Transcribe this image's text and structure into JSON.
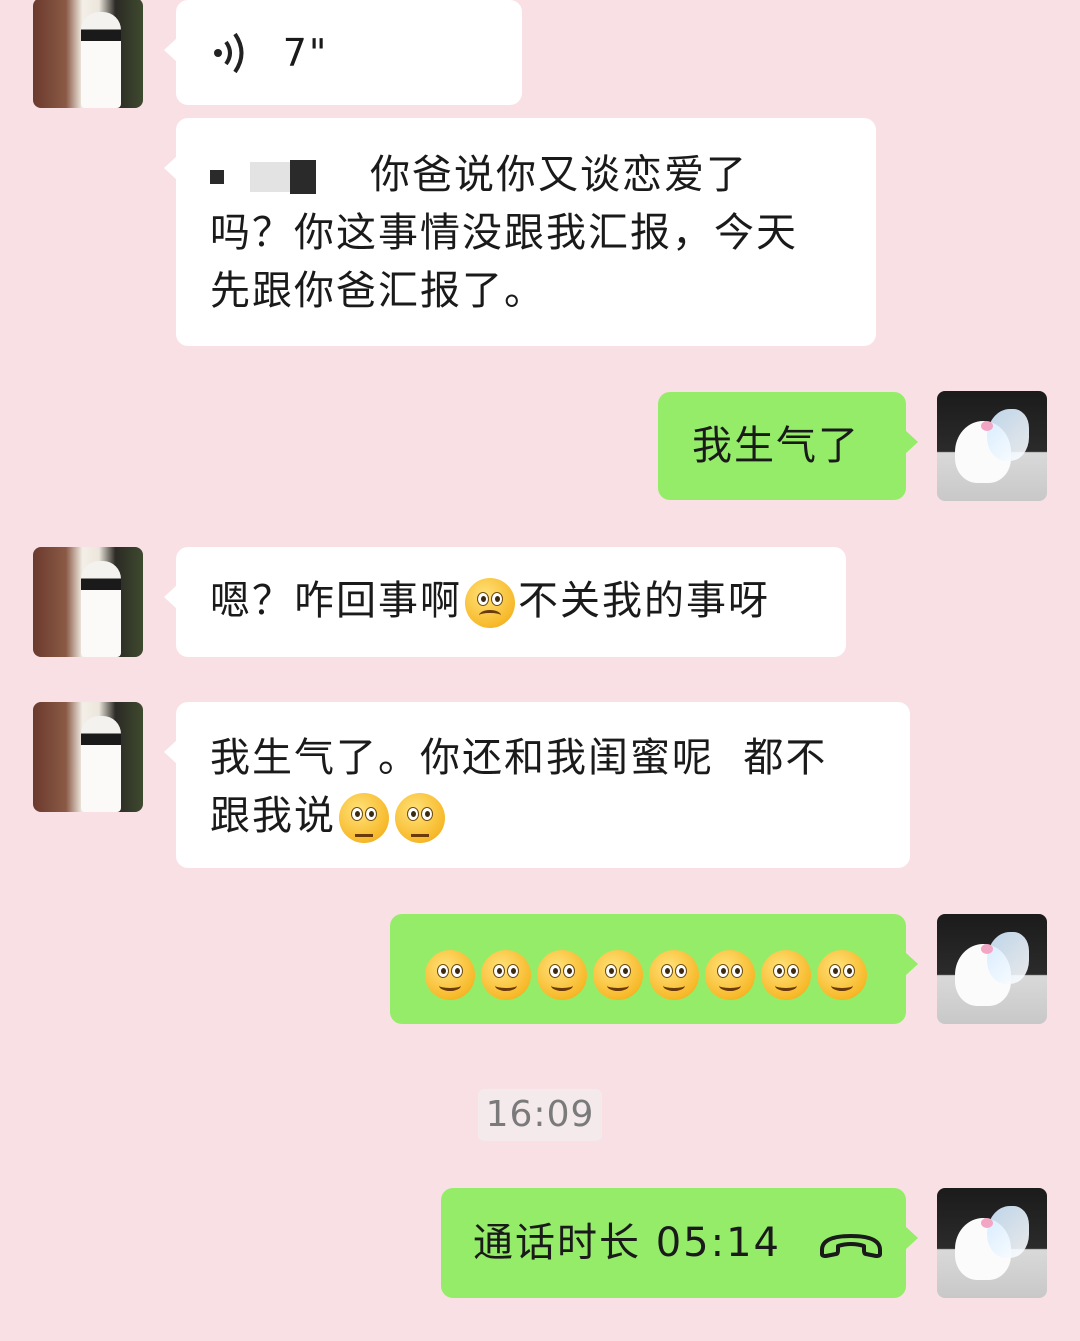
{
  "messages": [
    {
      "side": "left",
      "type": "voice",
      "duration": "7\""
    },
    {
      "side": "left",
      "type": "text",
      "lines": [
        "你爸说你又谈恋爱了",
        "吗？你这事情没跟我汇报，今天",
        "先跟你爸汇报了。"
      ]
    },
    {
      "side": "right",
      "type": "text",
      "text": "我生气了"
    },
    {
      "side": "left",
      "type": "text",
      "text_before": "嗯？咋回事啊",
      "emoji": "frowning-face",
      "text_after": "不关我的事呀"
    },
    {
      "side": "left",
      "type": "text",
      "lines": [
        "我生气了。你还和我闺蜜呢  都不",
        "跟我说"
      ],
      "emoji": [
        "pleading-face",
        "pleading-face"
      ]
    },
    {
      "side": "right",
      "type": "emoji",
      "emoji": "smiling-face",
      "count": 8
    },
    {
      "side": "right",
      "type": "call",
      "text": "通话时长 05:14",
      "icon": "phone-hangup-icon"
    }
  ],
  "timestamp": "16:09",
  "colors": {
    "background": "#f9e0e4",
    "incoming_bubble": "#ffffff",
    "outgoing_bubble": "#95ec69"
  }
}
